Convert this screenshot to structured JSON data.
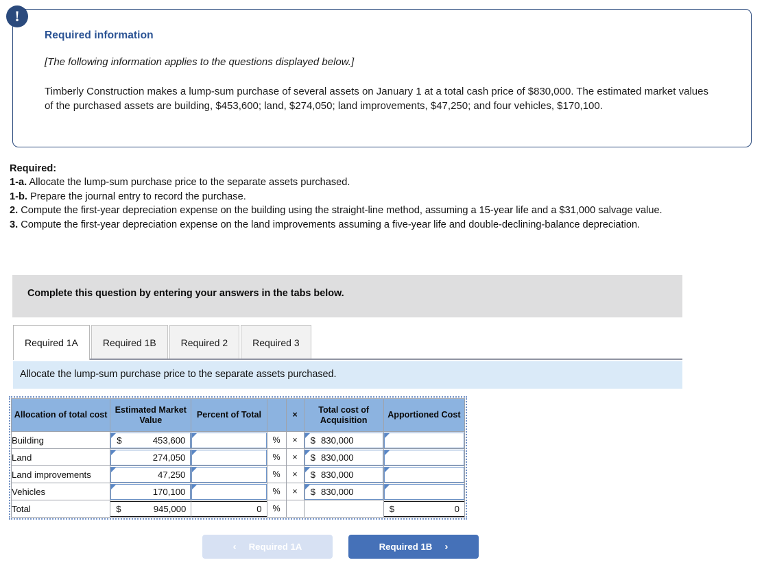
{
  "callout": {
    "badge_icon": "exclamation-icon",
    "title": "Required information",
    "italic_note": "[The following information applies to the questions displayed below.]",
    "body": "Timberly Construction makes a lump-sum purchase of several assets on January 1 at a total cash price of $830,000. The estimated market values of the purchased assets are building, $453,600; land, $274,050; land improvements, $47,250; and four vehicles, $170,100."
  },
  "required": {
    "heading": "Required:",
    "item_1a_num": "1-a.",
    "item_1a_text": " Allocate the lump-sum purchase price to the separate assets purchased.",
    "item_1b_num": "1-b.",
    "item_1b_text": " Prepare the journal entry to record the purchase.",
    "item_2_num": "2.",
    "item_2_text": " Compute the first-year depreciation expense on the building using the straight-line method, assuming a 15-year life and a $31,000 salvage value.",
    "item_3_num": "3.",
    "item_3_text": " Compute the first-year depreciation expense on the land improvements assuming a five-year life and double-declining-balance depreciation."
  },
  "banner": {
    "text": "Complete this question by entering your answers in the tabs below."
  },
  "tabs": {
    "items": [
      {
        "label": "Required 1A",
        "active": true
      },
      {
        "label": "Required 1B",
        "active": false
      },
      {
        "label": "Required 2",
        "active": false
      },
      {
        "label": "Required 3",
        "active": false
      }
    ]
  },
  "tab_content": {
    "instruction": "Allocate the lump-sum purchase price to the separate assets purchased."
  },
  "worksheet": {
    "headers": {
      "label": "Allocation of total cost",
      "emv": "Estimated Market Value",
      "percent": "Percent of Total",
      "times": "×",
      "tca": "Total cost of Acquisition",
      "apportioned": "Apportioned Cost"
    },
    "rows": [
      {
        "label": "Building",
        "emv_dollar": "$",
        "emv_value": "453,600",
        "percent_value": "",
        "percent_symbol": "%",
        "times": "×",
        "tca_dollar": "$",
        "tca_value": "830,000",
        "apportioned_value": ""
      },
      {
        "label": "Land",
        "emv_dollar": "",
        "emv_value": "274,050",
        "percent_value": "",
        "percent_symbol": "%",
        "times": "×",
        "tca_dollar": "$",
        "tca_value": "830,000",
        "apportioned_value": ""
      },
      {
        "label": "Land improvements",
        "emv_dollar": "",
        "emv_value": "47,250",
        "percent_value": "",
        "percent_symbol": "%",
        "times": "×",
        "tca_dollar": "$",
        "tca_value": "830,000",
        "apportioned_value": ""
      },
      {
        "label": "Vehicles",
        "emv_dollar": "",
        "emv_value": "170,100",
        "percent_value": "",
        "percent_symbol": "%",
        "times": "×",
        "tca_dollar": "$",
        "tca_value": "830,000",
        "apportioned_value": ""
      }
    ],
    "total_row": {
      "label": "Total",
      "emv_dollar": "$",
      "emv_value": "945,000",
      "percent_value": "0",
      "percent_symbol": "%",
      "times": "",
      "tca_dollar": "",
      "tca_value": "",
      "apportioned_dollar": "$",
      "apportioned_value": "0"
    }
  },
  "nav": {
    "prev_label": "Required 1A",
    "prev_chevron": "‹",
    "next_label": "Required 1B",
    "next_chevron": "›"
  },
  "colors": {
    "callout_border": "#2b4a7d",
    "callout_title": "#2b5394",
    "banner_gray": "#dededf",
    "strip_blue": "#daeaf8",
    "table_header_blue": "#8cb3e0",
    "input_border_blue": "#6f96cc",
    "btn_primary": "#4571b8",
    "btn_disabled": "#d7e1f3"
  }
}
